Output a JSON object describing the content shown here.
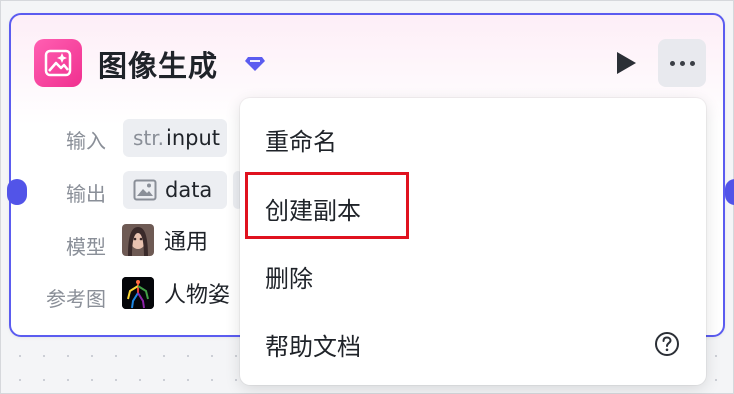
{
  "node": {
    "title": "图像生成",
    "rows": [
      {
        "label": "输入",
        "tag": "str.",
        "value": "input"
      },
      {
        "label": "输出",
        "value": "data"
      },
      {
        "label": "模型",
        "value": "通用"
      },
      {
        "label": "参考图",
        "value": "人物姿"
      }
    ]
  },
  "menu": {
    "items": [
      {
        "label": "重命名"
      },
      {
        "label": "创建副本"
      },
      {
        "label": "删除"
      },
      {
        "label": "帮助文档"
      }
    ]
  },
  "colors": {
    "accent": "#5b5cf0",
    "icon_bg": "#f0308f",
    "highlight": "#e0121f"
  }
}
